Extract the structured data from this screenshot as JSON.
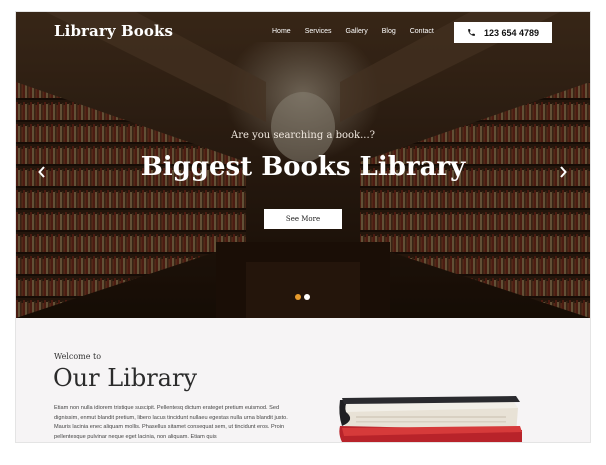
{
  "brand": "Library Books",
  "nav": {
    "items": [
      "Home",
      "Services",
      "Gallery",
      "Blog",
      "Contact"
    ],
    "phone": "123 654 4789"
  },
  "hero": {
    "subtitle": "Are you searching a book...?",
    "title": "Biggest Books Library",
    "button": "See More",
    "slide_count": 2,
    "active_slide": 1
  },
  "about": {
    "welcome": "Welcome to",
    "title": "Our Library",
    "text": "Etiam non nulla idiorem tristique suscipit. Pellentesq dictum erateget pretium euismod. Sed dignissim, enmut blandit pretium, libero lacus tincidunt nullaeu egestas nulla urna blandit justo. Mauris lacinia enec aliquam mollis. Phasellus sitamet consequat sem, ut tincidunt eros. Proin pellentesque pulvinar neque eget lacinia, non aliquam. Etiam quis"
  },
  "colors": {
    "dot_active": "#e79a2c",
    "dot_inactive": "#ffffff",
    "button_bg": "#ffffff"
  }
}
